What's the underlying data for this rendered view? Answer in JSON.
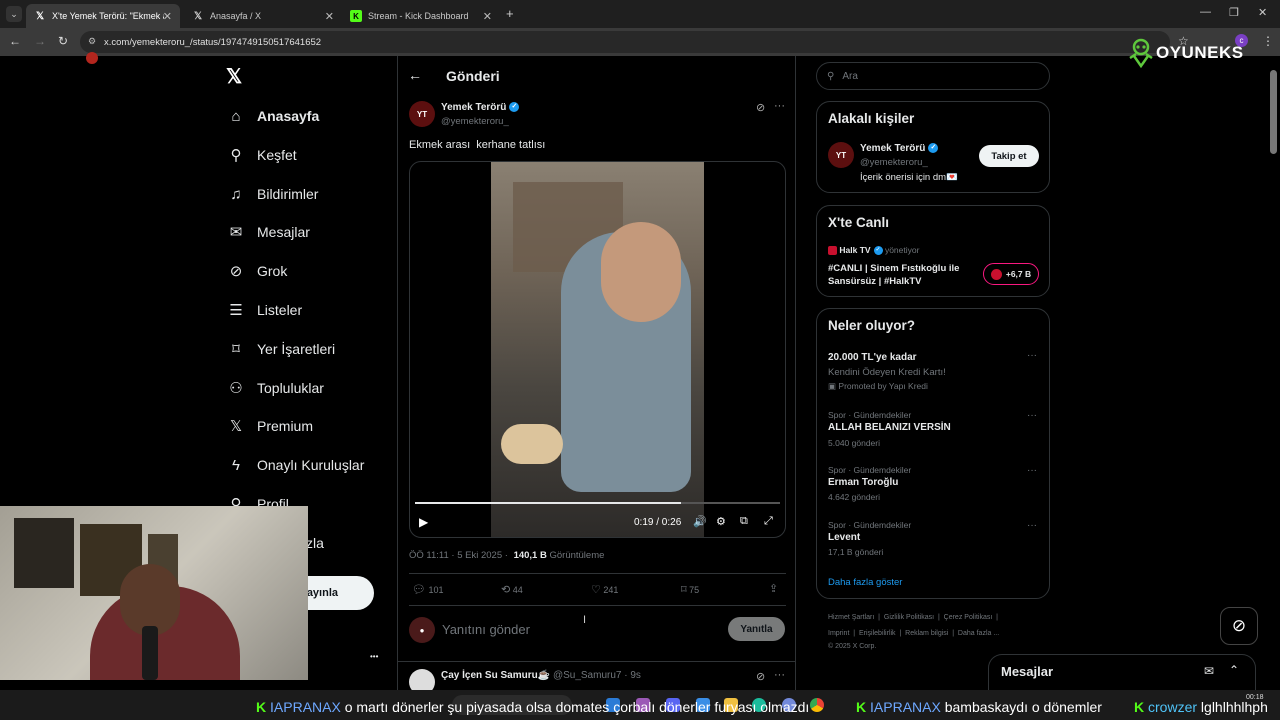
{
  "browser": {
    "tabs": [
      {
        "title": "X'te Yemek Terörü: \"Ekmek aras",
        "favicon": "x-logo"
      },
      {
        "title": "Anasayfa / X",
        "favicon": "x-logo"
      },
      {
        "title": "Stream - Kick Dashboard",
        "favicon": "kick-logo"
      }
    ],
    "new_tab": "+",
    "url": "x.com/yemekteroru_/status/1974749150517641652",
    "overlay_brand": "OYUNEKS"
  },
  "sidebar": {
    "items": [
      {
        "label": "Anasayfa",
        "icon": "home-icon",
        "glyph": "⌂"
      },
      {
        "label": "Keşfet",
        "icon": "search-icon",
        "glyph": "⌕"
      },
      {
        "label": "Bildirimler",
        "icon": "bell-icon",
        "glyph": "🔔"
      },
      {
        "label": "Mesajlar",
        "icon": "mail-icon",
        "glyph": "✉"
      },
      {
        "label": "Grok",
        "icon": "grok-icon",
        "glyph": "⊘"
      },
      {
        "label": "Listeler",
        "icon": "list-icon",
        "glyph": "☰"
      },
      {
        "label": "Yer İşaretleri",
        "icon": "bookmark-icon",
        "glyph": "🔖"
      },
      {
        "label": "Topluluklar",
        "icon": "communities-icon",
        "glyph": "👥"
      },
      {
        "label": "Premium",
        "icon": "x-premium-icon",
        "glyph": "𝕏"
      },
      {
        "label": "Onaylı Kuruluşlar",
        "icon": "lightning-icon",
        "glyph": "⚡"
      },
      {
        "label": "Profil",
        "icon": "profile-icon",
        "glyph": "👤"
      }
    ],
    "partial_more": "zla",
    "post_button": "ayınla",
    "more_dots": "•••"
  },
  "post": {
    "header_title": "Gönderi",
    "author_name": "Yemek Terörü",
    "author_handle": "@yemekteroru_",
    "text": "Ekmek arası  kerhane tatlısı",
    "video_time": "0:19 / 0:26",
    "timestamp": "ÖÖ 11:11 · 5 Eki 2025 ·",
    "views_count": "140,1 B",
    "views_label": "Görüntüleme",
    "stats": {
      "replies": "101",
      "reposts": "44",
      "likes": "241",
      "bookmarks": "75"
    },
    "reply_placeholder": "Yanıtını gönder",
    "reply_button": "Yanıtla",
    "next_author": "Çay İçen Su Samuru☕",
    "next_handle": "@Su_Samuru7 · 9s"
  },
  "right": {
    "search_placeholder": "Ara",
    "related_title": "Alakalı kişiler",
    "related_name": "Yemek Terörü",
    "related_handle": "@yemekteroru_",
    "related_bio": "İçerik önerisi için dm💌",
    "follow_button": "Takip et",
    "live_title": "X'te Canlı",
    "live_host": "Halk TV",
    "live_role": "yönetiyor",
    "live_text": "#CANLI | Sinem Fıstıkoğlu ile Sansürsüz | #HalkTV",
    "live_count": "+6,7 B",
    "trends_title": "Neler oluyor?",
    "trends": [
      {
        "meta": "",
        "name": "20.000 TL'ye kadar",
        "sub": "Kendini Ödeyen Kredi Kartı!",
        "extra": "Promoted by Yapı Kredi"
      },
      {
        "meta": "Spor · Gündemdekiler",
        "name": "ALLAH BELANIZI VERSİN",
        "sub": "5.040 gönderi",
        "extra": ""
      },
      {
        "meta": "Spor · Gündemdekiler",
        "name": "Erman Toroğlu",
        "sub": "4.642 gönderi",
        "extra": ""
      },
      {
        "meta": "Spor · Gündemdekiler",
        "name": "Levent",
        "sub": "17,1 B gönderi",
        "extra": ""
      }
    ],
    "show_more": "Daha fazla göster",
    "footer_line1": "Hizmet Şartları  |  Gizlilik Politikası  |  Çerez Politikası  |",
    "footer_line2": "Imprint  |  Erişilebilirlik  |  Reklam bilgisi  |  Daha fazla ...",
    "footer_line3": "© 2025 X Corp.",
    "messages_title": "Mesajlar"
  },
  "chat": {
    "msg1_user": "IAPRANAX",
    "msg1_text": "o martı dönerler şu piyasada olsa domates çorbalı dönerler furyası olmazdı",
    "msg2_user": "IAPRANAX",
    "msg2_text": "bambaskaydı o dönemler",
    "msg3_user": "crowzer",
    "msg3_text": "lglhlhhlhph",
    "clock": "00:18"
  },
  "colors": {
    "accent": "#1d9bf0",
    "kick": "#53fc18",
    "live": "#f91880"
  }
}
